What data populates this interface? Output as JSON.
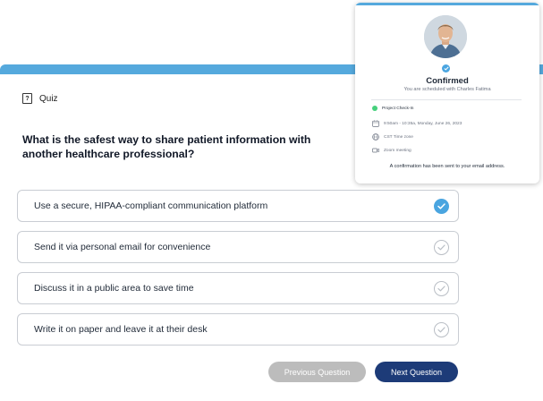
{
  "quiz": {
    "header_label": "Quiz",
    "question": "What is the safest way to share patient information with another healthcare professional?",
    "options": [
      {
        "label": "Use a secure, HIPAA-compliant communication platform",
        "selected": true
      },
      {
        "label": "Send it via personal email for convenience",
        "selected": false
      },
      {
        "label": "Discuss it in a public area to save time",
        "selected": false
      },
      {
        "label": "Write it on paper and leave it at their desk",
        "selected": false
      }
    ],
    "prev_label": "Previous Question",
    "next_label": "Next Question"
  },
  "confirmation": {
    "title": "Confirmed",
    "subtitle": "You are scheduled with Charles Fatima",
    "event_name": "Project Check-In",
    "datetime": "9:50am - 10:35a, Monday, June 26, 2023",
    "timezone": "CST Time zone",
    "meeting_type": "Zoom meeting",
    "message": "A confirmation has been sent to your email address."
  },
  "colors": {
    "accent": "#55a9dd",
    "selected_check": "#4aa5e0",
    "next_button": "#1d3b78",
    "prev_button": "#bcbcbc",
    "event_dot": "#46d07c"
  }
}
